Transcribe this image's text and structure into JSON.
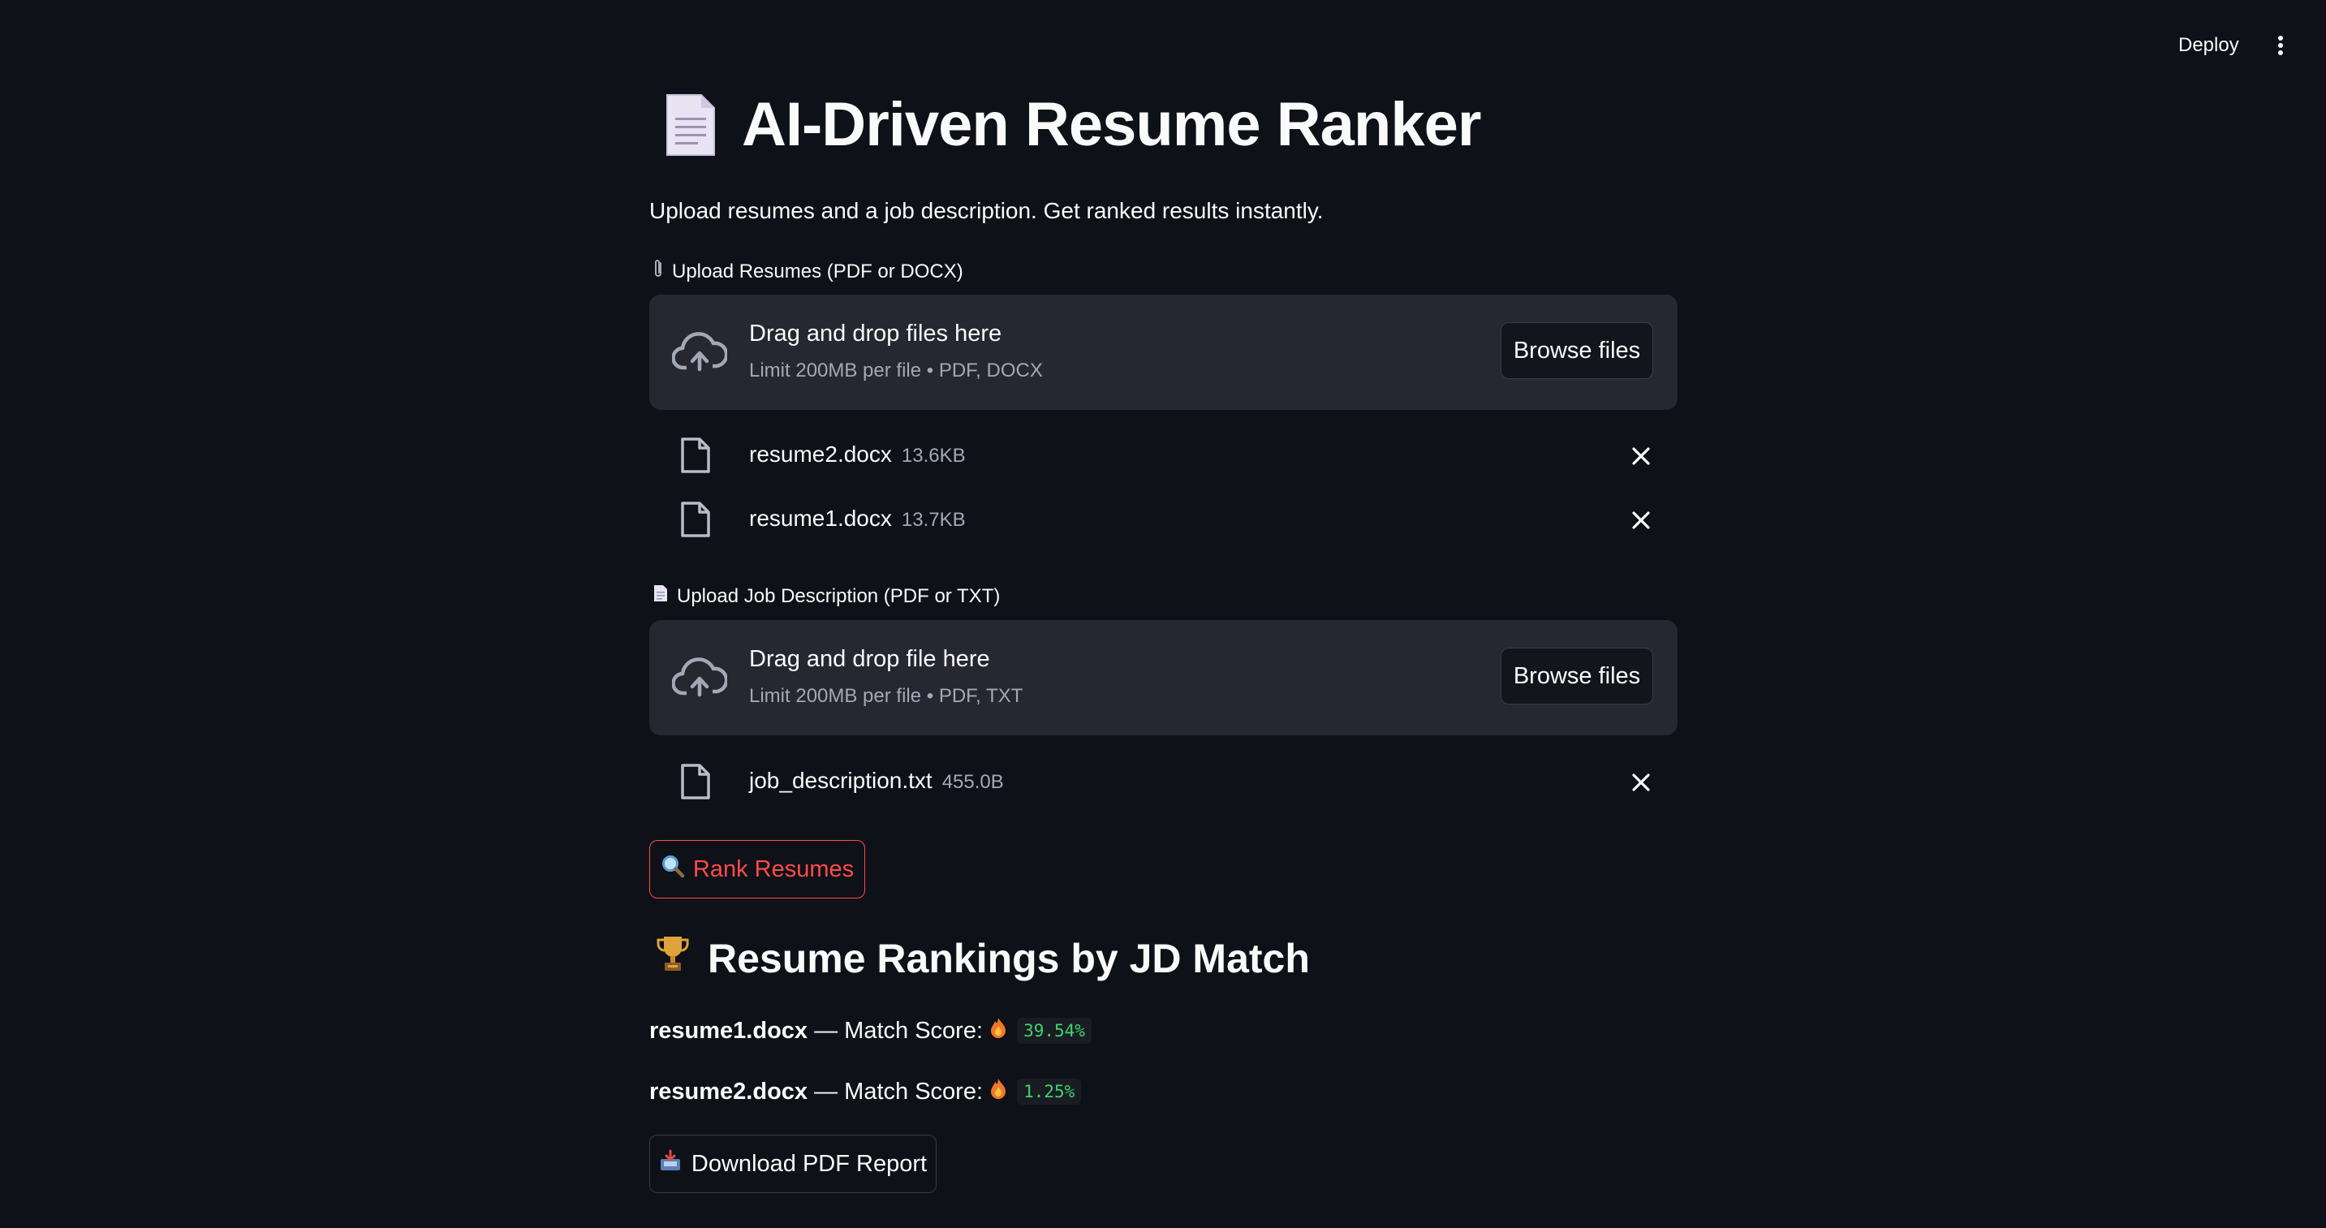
{
  "header": {
    "deploy_label": "Deploy",
    "menu_icon": "kebab-menu-icon"
  },
  "page": {
    "title": "AI-Driven Resume Ranker",
    "subtitle": "Upload resumes and a job description. Get ranked results instantly."
  },
  "resume_uploader": {
    "label": "Upload Resumes (PDF or DOCX)",
    "label_icon": "paperclip-icon",
    "drop_text": "Drag and drop files here",
    "limit_text": "Limit 200MB per file • PDF, DOCX",
    "browse_label": "Browse files",
    "files": [
      {
        "name": "resume2.docx",
        "size": "13.6KB"
      },
      {
        "name": "resume1.docx",
        "size": "13.7KB"
      }
    ]
  },
  "jd_uploader": {
    "label": "Upload Job Description (PDF or TXT)",
    "label_icon": "page-icon",
    "drop_text": "Drag and drop file here",
    "limit_text": "Limit 200MB per file • PDF, TXT",
    "browse_label": "Browse files",
    "files": [
      {
        "name": "job_description.txt",
        "size": "455.0B"
      }
    ]
  },
  "rank_button": {
    "label": "Rank Resumes",
    "icon": "magnifier-icon",
    "color": "#ff4b4b"
  },
  "rankings": {
    "title": "Resume Rankings by JD Match",
    "icon": "trophy-icon",
    "results": [
      {
        "file": "resume1.docx",
        "text": " — Match Score: ",
        "score": "39.54%"
      },
      {
        "file": "resume2.docx",
        "text": " — Match Score: ",
        "score": "1.25%"
      }
    ],
    "score_color": "#3dd56d"
  },
  "download_button": {
    "label": "Download PDF Report",
    "icon": "inbox-tray-icon"
  }
}
